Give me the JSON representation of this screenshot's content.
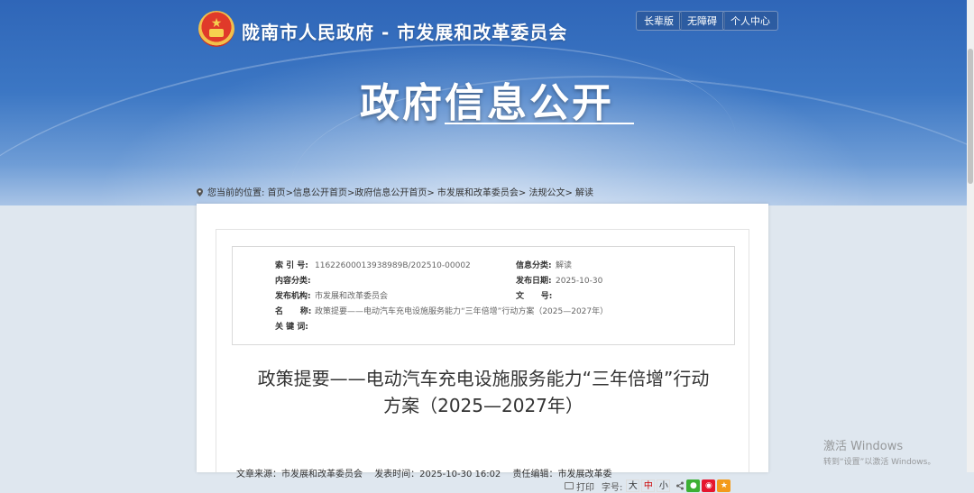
{
  "header": {
    "site_title": "陇南市人民政府 - 市发展和改革委员会",
    "buttons": [
      "长辈版",
      "无障碍",
      "个人中心"
    ],
    "banner_title": "政府信息公开"
  },
  "breadcrumb": {
    "prefix": "您当前的位置:",
    "items": [
      "首页",
      ">信息公开首页",
      ">政府信息公开首页",
      "> 市发展和改革委员会",
      "> 法规公文",
      "> 解读"
    ]
  },
  "meta": {
    "index_label": "索 引 号:",
    "index_value": "11622600013938989B/202510-00002",
    "info_category_label": "信息分类:",
    "info_category_value": "解读",
    "content_category_label": "内容分类:",
    "content_category_value": "",
    "publish_date_label": "发布日期:",
    "publish_date_value": "2025-10-30",
    "agency_label": "发布机构:",
    "agency_value": "市发展和改革委员会",
    "doc_no_label": "文      号:",
    "doc_no_value": "",
    "name_label": "名      称:",
    "name_value": "政策提要——电动汽车充电设施服务能力“三年倍增”行动方案（2025—2027年）",
    "keywords_label": "关 键 词:",
    "keywords_value": ""
  },
  "article": {
    "title_line1": "政策提要——电动汽车充电设施服务能力“三年倍增”行动",
    "title_line2": "方案（2025—2027年）",
    "source": "文章来源：市发展和改革委员会",
    "time": "发表时间：2025-10-30 16:02",
    "editor": "责任编辑：市发展改革委"
  },
  "tools": {
    "print": "打印",
    "font_label": "字号:",
    "font_sizes": [
      "大",
      "中",
      "小"
    ],
    "share_colors": {
      "wechat": "#3cb034",
      "weibo": "#e6162d",
      "favorite": "#f39a1b"
    }
  },
  "watermark": {
    "line1": "激活 Windows",
    "line2": "转到“设置”以激活 Windows。"
  }
}
